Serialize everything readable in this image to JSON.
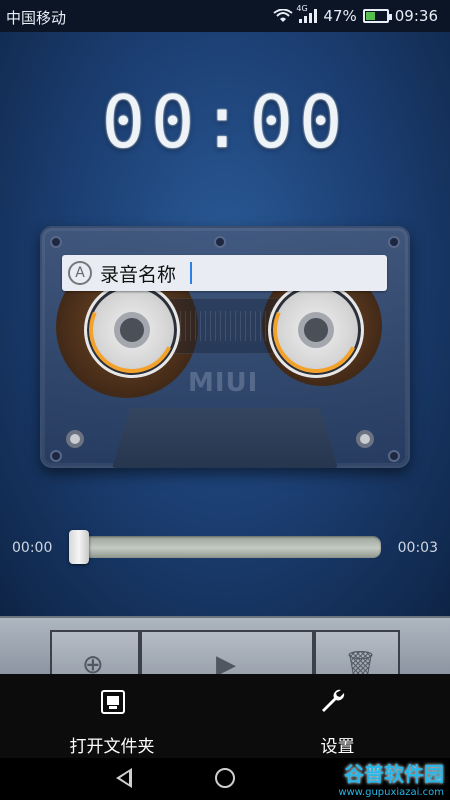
{
  "status_bar": {
    "carrier": "中国移动",
    "network_type": "4G",
    "battery_percent": "47%",
    "battery_level": 0.47,
    "time": "09:36"
  },
  "recorder": {
    "timer": "00:00",
    "recording_name": "录音名称",
    "name_field_icon_letter": "A",
    "cassette_brand": "MIUI",
    "progress": {
      "current_time": "00:00",
      "total_time": "00:03",
      "position_fraction": 0.0
    }
  },
  "popup_menu": {
    "items": [
      {
        "label": "打开文件夹",
        "icon": "folder-icon"
      },
      {
        "label": "设置",
        "icon": "wrench-icon"
      }
    ]
  },
  "nav_bar": {
    "buttons": [
      "back",
      "home"
    ]
  },
  "watermark": {
    "title": "谷普软件园",
    "url": "www.gupuxiazai.com"
  },
  "colors": {
    "background_top": "#1d4176",
    "battery_fill": "#55c04f",
    "caret": "#2a80e5",
    "menu_bg": "#0c0c0c",
    "watermark": "#28b7e8"
  }
}
